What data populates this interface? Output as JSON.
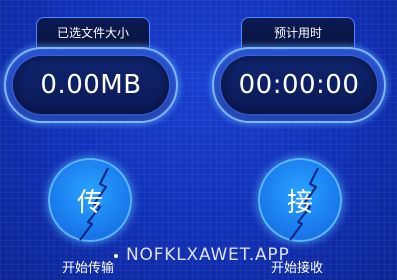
{
  "left_panel": {
    "tab_label": "已选文件大小",
    "value": "0.00MB"
  },
  "right_panel": {
    "tab_label": "预计用时",
    "value": "00:00:00"
  },
  "send_button": {
    "glyph": "传",
    "caption": "开始传输"
  },
  "receive_button": {
    "glyph": "接",
    "caption": "开始接收"
  },
  "watermark": "NOFKLXAWET.APP",
  "icons": [
    "lightning-icon",
    "lightning-icon"
  ],
  "colors": {
    "background": "#1230b4",
    "accent": "#7fb6ff",
    "button_fill": "#1b7ff0"
  }
}
